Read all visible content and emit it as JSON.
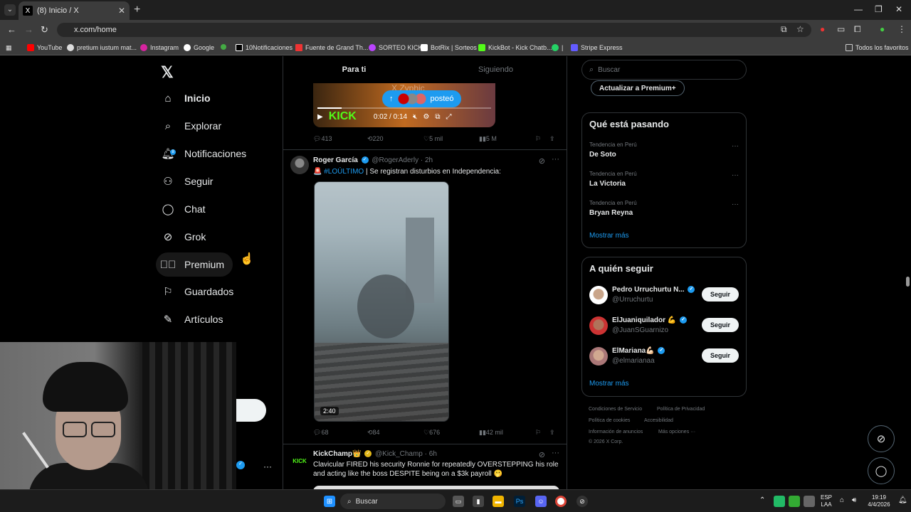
{
  "browser": {
    "tab_title": "(8) Inicio / X",
    "url": "x.com/home",
    "bookmarks": [
      "YouTube",
      "pretium iustum mat...",
      "Instagram",
      "Google",
      "10Notificaciones",
      "Fuente de Grand Th...",
      "SORTEO KICK",
      "BotRix | Sorteos",
      "KickBot - Kick Chatb...",
      "Stripe Express",
      "Todos los favoritos"
    ],
    "bookmark_separator": "|"
  },
  "sidebar": {
    "items": [
      {
        "label": "Inicio",
        "icon": "home-icon"
      },
      {
        "label": "Explorar",
        "icon": "search-icon"
      },
      {
        "label": "Notificaciones",
        "icon": "bell-icon",
        "badge": "8"
      },
      {
        "label": "Seguir",
        "icon": "person-plus-icon"
      },
      {
        "label": "Chat",
        "icon": "chat-icon"
      },
      {
        "label": "Grok",
        "icon": "grok-icon"
      },
      {
        "label": "Premium",
        "icon": "premium-icon"
      },
      {
        "label": "Guardados",
        "icon": "bookmark-icon"
      },
      {
        "label": "Artículos",
        "icon": "article-icon"
      }
    ],
    "partial_label": "es"
  },
  "feed": {
    "tabs": [
      "Para ti",
      "Siguiendo"
    ],
    "posted_pill": "posteó",
    "video_time": "0:02 / 0:14",
    "video_watermark": "X Zyphic",
    "video_brand": "KICK",
    "post1_actions": {
      "replies": "413",
      "reposts": "220",
      "likes": "5 mil",
      "views": "5 M"
    },
    "post2": {
      "name": "Roger García",
      "handle": "@RogerAderly",
      "time": "· 2h",
      "emoji": "🚨",
      "hashtag": "#LOÚLTIMO",
      "text": " | Se registran disturbios en Independencia:",
      "duration": "2:40",
      "actions": {
        "replies": "68",
        "reposts": "84",
        "likes": "676",
        "views": "42 mil"
      }
    },
    "post3": {
      "name": "KickChamp👑",
      "handle": "@Kick_Champ",
      "time": "· 6h",
      "text": "Clavicular FIRED his security Ronnie for repeatedly OVERSTEPPING his role and acting like the boss DESPITE being on a $3k payroll 🫢"
    }
  },
  "right": {
    "search_placeholder": "Buscar",
    "premium_button": "Actualizar a Premium+",
    "trends_title": "Qué está pasando",
    "trends": [
      {
        "category": "Tendencia en Perú",
        "name": "De Soto"
      },
      {
        "category": "Tendencia en Perú",
        "name": "La Victoria"
      },
      {
        "category": "Tendencia en Perú",
        "name": "Bryan Reyna"
      }
    ],
    "show_more": "Mostrar más",
    "wtf_title": "A quién seguir",
    "wtf": [
      {
        "name": "Pedro Urruchurtu N...",
        "handle": "@Urruchurtu",
        "button": "Seguir"
      },
      {
        "name": "ElJuaniquilador 💪",
        "handle": "@JuanSGuarnizo",
        "button": "Seguir"
      },
      {
        "name": "ElMariana💪🏻",
        "handle": "@elmarianaa",
        "button": "Seguir"
      }
    ],
    "footer": [
      "Condiciones de Servicio",
      "Política de Privacidad",
      "Política de cookies",
      "Accesibilidad",
      "Información de anuncios",
      "Más opciones ···",
      "© 2026 X Corp."
    ]
  },
  "taskbar": {
    "search": "Buscar",
    "lang": "ESP",
    "lang2": "LAA",
    "time": "19:19",
    "date": "4/4/2026",
    "ps_label": "Ps"
  },
  "colors": {
    "accent": "#1d9bf0",
    "background": "#000000",
    "kick_green": "#53fc18"
  }
}
